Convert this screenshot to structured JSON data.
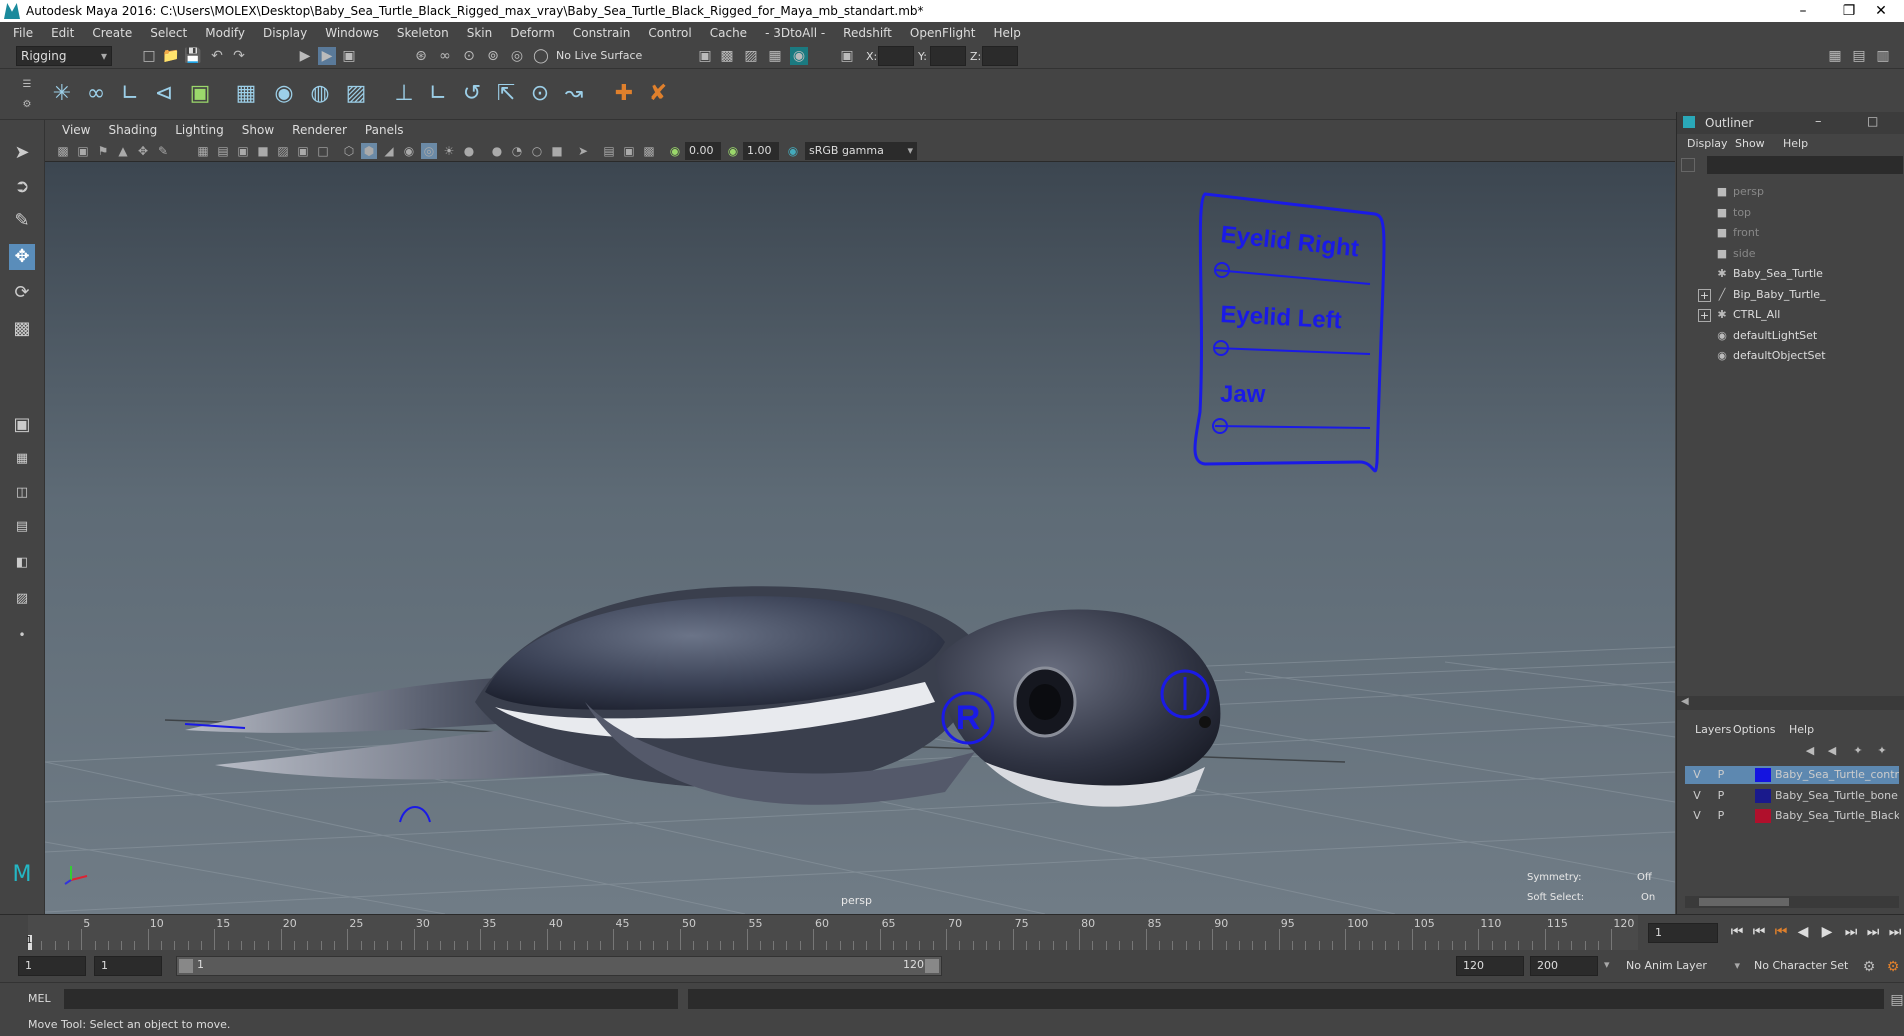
{
  "window": {
    "title": "Autodesk Maya 2016: C:\\Users\\MOLEX\\Desktop\\Baby_Sea_Turtle_Black_Rigged_max_vray\\Baby_Sea_Turtle_Black_Rigged_for_Maya_mb_standart.mb*"
  },
  "menubar": [
    "File",
    "Edit",
    "Create",
    "Select",
    "Modify",
    "Display",
    "Windows",
    "Skeleton",
    "Skin",
    "Deform",
    "Constrain",
    "Control",
    "Cache",
    "- 3DtoAll -",
    "Redshift",
    "OpenFlight",
    "Help"
  ],
  "statusline": {
    "mode": "Rigging",
    "live_surface": "No Live Surface",
    "x_label": "X:",
    "y_label": "Y:",
    "z_label": "Z:"
  },
  "viewport": {
    "menu": [
      "View",
      "Shading",
      "Lighting",
      "Show",
      "Renderer",
      "Panels"
    ],
    "field_a": "0.00",
    "field_b": "1.00",
    "color_space": "sRGB gamma",
    "camera_label": "persp",
    "symmetry_label": "Symmetry:",
    "symmetry_value": "Off",
    "soft_select_label": "Soft Select:",
    "soft_select_value": "On",
    "controls": {
      "eyelid_right": "Eyelid Right",
      "eyelid_left": "Eyelid Left",
      "jaw": "Jaw",
      "r_marker": "R"
    },
    "colors": {
      "rig": "#1a1ae6"
    }
  },
  "outliner": {
    "title": "Outliner",
    "menu": [
      "Display",
      "Show",
      "Help"
    ],
    "items": [
      {
        "label": "persp",
        "icon": "camera-icon",
        "dim": true
      },
      {
        "label": "top",
        "icon": "camera-icon",
        "dim": true
      },
      {
        "label": "front",
        "icon": "camera-icon",
        "dim": true
      },
      {
        "label": "side",
        "icon": "camera-icon",
        "dim": true
      },
      {
        "label": "Baby_Sea_Turtle",
        "icon": "transform-icon",
        "dim": false
      },
      {
        "label": "Bip_Baby_Turtle_",
        "icon": "joint-icon",
        "dim": false,
        "expandable": true
      },
      {
        "label": "CTRL_All",
        "icon": "transform-icon",
        "dim": false,
        "expandable": true
      },
      {
        "label": "defaultLightSet",
        "icon": "set-icon",
        "dim": false
      },
      {
        "label": "defaultObjectSet",
        "icon": "set-icon",
        "dim": false
      }
    ]
  },
  "layers": {
    "menu": [
      "Layers",
      "Options",
      "Help"
    ],
    "rows": [
      {
        "v": "V",
        "p": "P",
        "name": "Baby_Sea_Turtle_contr",
        "color": "#1414e0",
        "selected": true
      },
      {
        "v": "V",
        "p": "P",
        "name": "Baby_Sea_Turtle_bone",
        "color": "#1a1a8c",
        "selected": false
      },
      {
        "v": "V",
        "p": "P",
        "name": "Baby_Sea_Turtle_Black",
        "color": "#b0102c",
        "selected": false
      }
    ]
  },
  "timeline": {
    "ticks": [
      5,
      10,
      15,
      20,
      25,
      30,
      35,
      40,
      45,
      50,
      55,
      60,
      65,
      70,
      75,
      80,
      85,
      90,
      95,
      100,
      105,
      110,
      115,
      120
    ],
    "current_frame": "1",
    "marker_label": "1"
  },
  "range": {
    "start": "1",
    "start_inner": "1",
    "slider_start": "1",
    "slider_end": "120",
    "end_inner": "120",
    "end": "200",
    "anim_layer": "No Anim Layer",
    "character_set": "No Character Set"
  },
  "cmdline": {
    "label": "MEL"
  },
  "helpline": {
    "text": "Move Tool: Select an object to move."
  }
}
